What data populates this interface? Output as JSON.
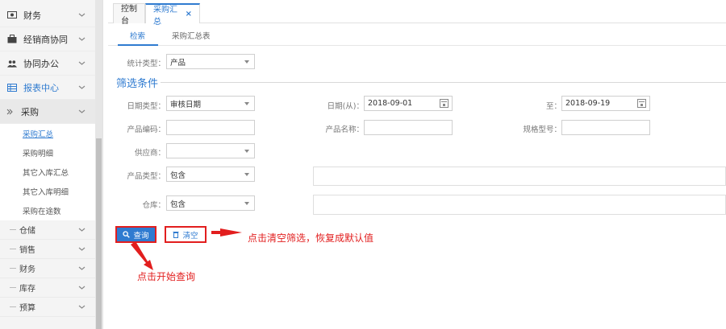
{
  "sidebar": {
    "items": [
      {
        "label": "财务",
        "icon": "money-icon"
      },
      {
        "label": "经销商协同",
        "icon": "briefcase-icon"
      },
      {
        "label": "协同办公",
        "icon": "users-icon"
      },
      {
        "label": "报表中心",
        "icon": "table-icon"
      }
    ],
    "submenu_label": "采购",
    "leaves": [
      "采购汇总",
      "采购明细",
      "其它入库汇总",
      "其它入库明细",
      "采购在途数"
    ],
    "subsections": [
      "仓储",
      "销售",
      "财务",
      "库存",
      "预算"
    ]
  },
  "tabs": [
    {
      "label": "控制台"
    },
    {
      "label": "采购汇总",
      "close": "×"
    }
  ],
  "subtabs": [
    "检索",
    "采购汇总表"
  ],
  "form": {
    "stat_type_label": "统计类型：",
    "stat_type_value": "产品",
    "filter_title": "筛选条件",
    "date_type_label": "日期类型：",
    "date_type_value": "审核日期",
    "date_from_label": "日期(从)：",
    "date_from_value": "2018-09-01",
    "date_to_label": "至：",
    "date_to_value": "2018-09-19",
    "product_code_label": "产品编码：",
    "product_name_label": "产品名称：",
    "spec_label": "规格型号：",
    "supplier_label": "供应商：",
    "product_type_label": "产品类型：",
    "product_type_value": "包含",
    "warehouse_label": "仓库：",
    "warehouse_value": "包含"
  },
  "buttons": {
    "query": "查询",
    "clear": "清空"
  },
  "annotations": {
    "clear_note": "点击清空筛选，恢复成默认值",
    "query_note": "点击开始查询"
  },
  "colors": {
    "accent": "#2f7bd0",
    "annotation": "#e21e1e"
  }
}
